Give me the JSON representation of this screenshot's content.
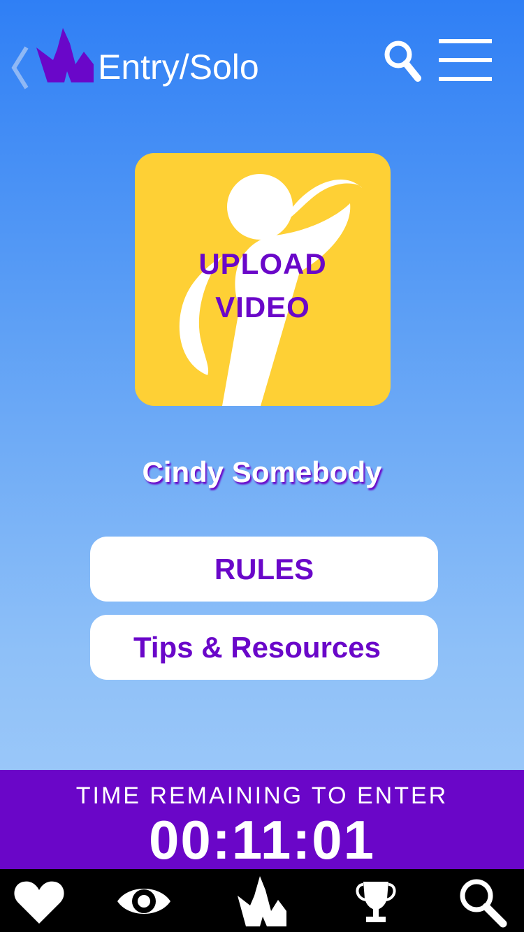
{
  "header": {
    "title": "Entry/Solo",
    "back_icon": "chevron-left-icon",
    "logo_icon": "crown-logo-icon",
    "search_icon": "search-icon",
    "menu_icon": "hamburger-menu-icon"
  },
  "upload": {
    "line1": "UPLOAD",
    "line2": "VIDEO",
    "icon": "dancer-figure-icon"
  },
  "user": {
    "name": "Cindy Somebody"
  },
  "buttons": {
    "rules": "RULES",
    "tips": "Tips & Resources"
  },
  "timer": {
    "label": "TIME REMAINING TO ENTER",
    "value": "00:11:01"
  },
  "bottom_nav": [
    {
      "icon": "heart-icon"
    },
    {
      "icon": "eye-icon"
    },
    {
      "icon": "crown-logo-icon"
    },
    {
      "icon": "trophy-icon"
    },
    {
      "icon": "search-icon"
    }
  ],
  "colors": {
    "accent_purple": "#6a06c8",
    "tile_yellow": "#fed035",
    "background_top": "#2f7ff5",
    "background_bottom": "#a9d0fa"
  }
}
